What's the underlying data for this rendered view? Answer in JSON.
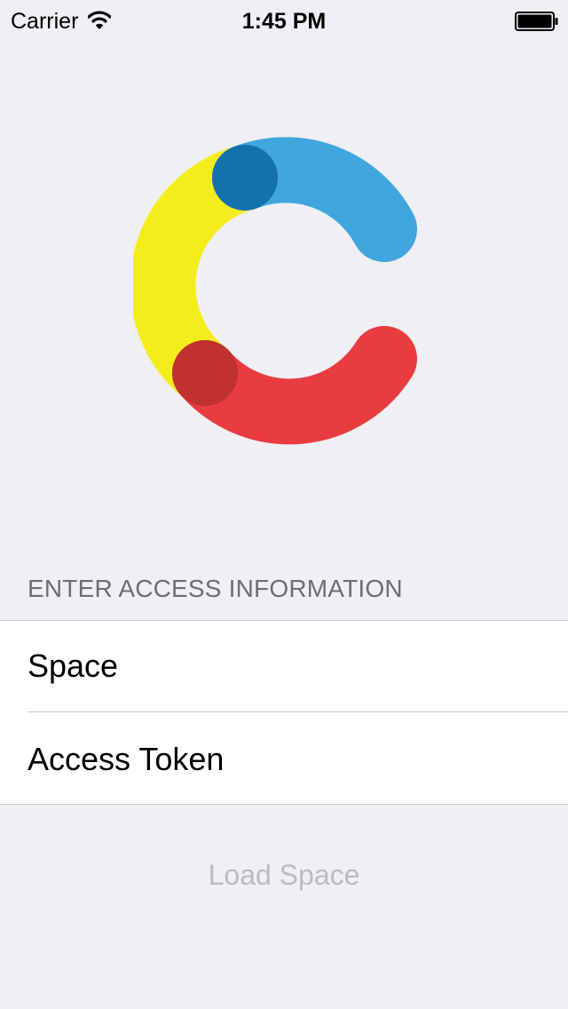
{
  "status_bar": {
    "carrier": "Carrier",
    "time": "1:45 PM"
  },
  "logo": {
    "colors": {
      "yellow": "#f5ed1b",
      "blue": "#3fa6de",
      "blue_dark": "#1371ab",
      "red": "#e93c40",
      "red_dark": "#c0312f"
    }
  },
  "form": {
    "section_header": "ENTER ACCESS INFORMATION",
    "fields": [
      {
        "label": "Space",
        "value": ""
      },
      {
        "label": "Access Token",
        "value": ""
      }
    ],
    "load_button": "Load Space"
  },
  "colors": {
    "background": "#efeff4",
    "header_text": "#6d6d72",
    "separator": "#c8c7cc",
    "disabled_button": "#bcbcc0"
  }
}
